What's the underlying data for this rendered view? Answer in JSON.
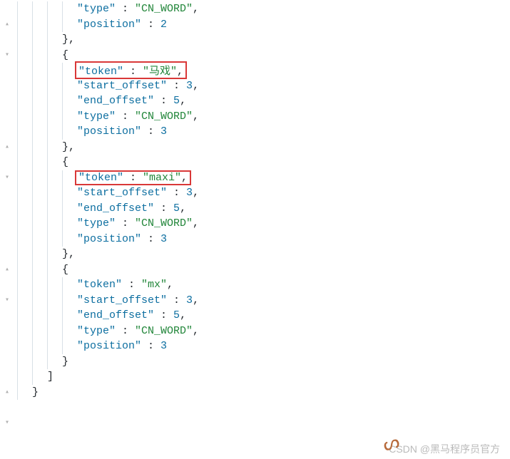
{
  "gutter_marks": [
    "",
    "▴",
    "",
    "▾",
    "",
    "",
    "",
    "",
    "",
    "▴",
    "",
    "▾",
    "",
    "",
    "",
    "",
    "",
    "▴",
    "",
    "▾",
    "",
    "",
    "",
    "",
    "",
    "▴",
    "",
    "▾",
    ""
  ],
  "blocks": [
    {
      "indent": 4,
      "text": "\"type\" : \"CN_WORD\",",
      "highlight": false,
      "parts": [
        {
          "t": "\"type\"",
          "c": "key"
        },
        {
          "t": " : ",
          "c": "punct"
        },
        {
          "t": "\"CN_WORD\"",
          "c": "str"
        },
        {
          "t": ",",
          "c": "punct"
        }
      ]
    },
    {
      "indent": 4,
      "text": "\"position\" : 2",
      "highlight": false,
      "parts": [
        {
          "t": "\"position\"",
          "c": "key"
        },
        {
          "t": " : ",
          "c": "punct"
        },
        {
          "t": "2",
          "c": "num"
        }
      ]
    },
    {
      "indent": 3,
      "text": "},",
      "highlight": false,
      "parts": [
        {
          "t": "},",
          "c": "punct"
        }
      ]
    },
    {
      "indent": 3,
      "text": "{",
      "highlight": false,
      "parts": [
        {
          "t": "{",
          "c": "punct"
        }
      ]
    },
    {
      "indent": 4,
      "text": "\"token\" : \"马戏\",",
      "highlight": true,
      "parts": [
        {
          "t": "\"token\"",
          "c": "key"
        },
        {
          "t": " : ",
          "c": "punct"
        },
        {
          "t": "\"马戏\"",
          "c": "str"
        },
        {
          "t": ",",
          "c": "punct"
        }
      ]
    },
    {
      "indent": 4,
      "text": "\"start_offset\" : 3,",
      "highlight": false,
      "parts": [
        {
          "t": "\"start_offset\"",
          "c": "key"
        },
        {
          "t": " : ",
          "c": "punct"
        },
        {
          "t": "3",
          "c": "num"
        },
        {
          "t": ",",
          "c": "punct"
        }
      ]
    },
    {
      "indent": 4,
      "text": "\"end_offset\" : 5,",
      "highlight": false,
      "parts": [
        {
          "t": "\"end_offset\"",
          "c": "key"
        },
        {
          "t": " : ",
          "c": "punct"
        },
        {
          "t": "5",
          "c": "num"
        },
        {
          "t": ",",
          "c": "punct"
        }
      ]
    },
    {
      "indent": 4,
      "text": "\"type\" : \"CN_WORD\",",
      "highlight": false,
      "parts": [
        {
          "t": "\"type\"",
          "c": "key"
        },
        {
          "t": " : ",
          "c": "punct"
        },
        {
          "t": "\"CN_WORD\"",
          "c": "str"
        },
        {
          "t": ",",
          "c": "punct"
        }
      ]
    },
    {
      "indent": 4,
      "text": "\"position\" : 3",
      "highlight": false,
      "parts": [
        {
          "t": "\"position\"",
          "c": "key"
        },
        {
          "t": " : ",
          "c": "punct"
        },
        {
          "t": "3",
          "c": "num"
        }
      ]
    },
    {
      "indent": 3,
      "text": "},",
      "highlight": false,
      "parts": [
        {
          "t": "},",
          "c": "punct"
        }
      ]
    },
    {
      "indent": 3,
      "text": "{",
      "highlight": false,
      "parts": [
        {
          "t": "{",
          "c": "punct"
        }
      ]
    },
    {
      "indent": 4,
      "text": "\"token\" : \"maxi\",",
      "highlight": true,
      "parts": [
        {
          "t": "\"token\"",
          "c": "key"
        },
        {
          "t": " : ",
          "c": "punct"
        },
        {
          "t": "\"maxi\"",
          "c": "str"
        },
        {
          "t": ",",
          "c": "punct"
        }
      ]
    },
    {
      "indent": 4,
      "text": "\"start_offset\" : 3,",
      "highlight": false,
      "parts": [
        {
          "t": "\"start_offset\"",
          "c": "key"
        },
        {
          "t": " : ",
          "c": "punct"
        },
        {
          "t": "3",
          "c": "num"
        },
        {
          "t": ",",
          "c": "punct"
        }
      ]
    },
    {
      "indent": 4,
      "text": "\"end_offset\" : 5,",
      "highlight": false,
      "parts": [
        {
          "t": "\"end_offset\"",
          "c": "key"
        },
        {
          "t": " : ",
          "c": "punct"
        },
        {
          "t": "5",
          "c": "num"
        },
        {
          "t": ",",
          "c": "punct"
        }
      ]
    },
    {
      "indent": 4,
      "text": "\"type\" : \"CN_WORD\",",
      "highlight": false,
      "parts": [
        {
          "t": "\"type\"",
          "c": "key"
        },
        {
          "t": " : ",
          "c": "punct"
        },
        {
          "t": "\"CN_WORD\"",
          "c": "str"
        },
        {
          "t": ",",
          "c": "punct"
        }
      ]
    },
    {
      "indent": 4,
      "text": "\"position\" : 3",
      "highlight": false,
      "parts": [
        {
          "t": "\"position\"",
          "c": "key"
        },
        {
          "t": " : ",
          "c": "punct"
        },
        {
          "t": "3",
          "c": "num"
        }
      ]
    },
    {
      "indent": 3,
      "text": "},",
      "highlight": false,
      "parts": [
        {
          "t": "},",
          "c": "punct"
        }
      ]
    },
    {
      "indent": 3,
      "text": "{",
      "highlight": false,
      "parts": [
        {
          "t": "{",
          "c": "punct"
        }
      ]
    },
    {
      "indent": 4,
      "text": "\"token\" : \"mx\",",
      "highlight": false,
      "parts": [
        {
          "t": "\"token\"",
          "c": "key"
        },
        {
          "t": " : ",
          "c": "punct"
        },
        {
          "t": "\"mx\"",
          "c": "str"
        },
        {
          "t": ",",
          "c": "punct"
        }
      ]
    },
    {
      "indent": 4,
      "text": "\"start_offset\" : 3,",
      "highlight": false,
      "parts": [
        {
          "t": "\"start_offset\"",
          "c": "key"
        },
        {
          "t": " : ",
          "c": "punct"
        },
        {
          "t": "3",
          "c": "num"
        },
        {
          "t": ",",
          "c": "punct"
        }
      ]
    },
    {
      "indent": 4,
      "text": "\"end_offset\" : 5,",
      "highlight": false,
      "parts": [
        {
          "t": "\"end_offset\"",
          "c": "key"
        },
        {
          "t": " : ",
          "c": "punct"
        },
        {
          "t": "5",
          "c": "num"
        },
        {
          "t": ",",
          "c": "punct"
        }
      ]
    },
    {
      "indent": 4,
      "text": "\"type\" : \"CN_WORD\",",
      "highlight": false,
      "parts": [
        {
          "t": "\"type\"",
          "c": "key"
        },
        {
          "t": " : ",
          "c": "punct"
        },
        {
          "t": "\"CN_WORD\"",
          "c": "str"
        },
        {
          "t": ",",
          "c": "punct"
        }
      ]
    },
    {
      "indent": 4,
      "text": "\"position\" : 3",
      "highlight": false,
      "parts": [
        {
          "t": "\"position\"",
          "c": "key"
        },
        {
          "t": " : ",
          "c": "punct"
        },
        {
          "t": "3",
          "c": "num"
        }
      ]
    },
    {
      "indent": 3,
      "text": "}",
      "highlight": false,
      "parts": [
        {
          "t": "}",
          "c": "punct"
        }
      ]
    },
    {
      "indent": 2,
      "text": "]",
      "highlight": false,
      "parts": [
        {
          "t": "]",
          "c": "punct"
        }
      ]
    },
    {
      "indent": 1,
      "text": "}",
      "highlight": false,
      "parts": [
        {
          "t": "}",
          "c": "punct"
        }
      ]
    }
  ],
  "watermark": "CSDN @黑马程序员官方"
}
